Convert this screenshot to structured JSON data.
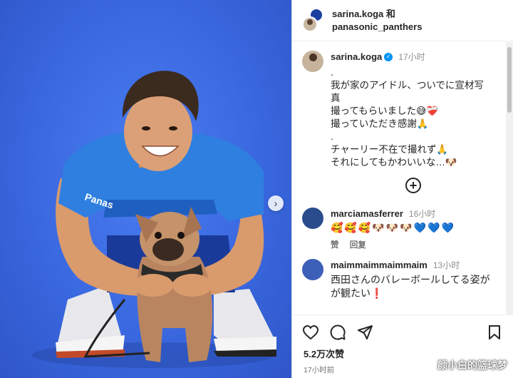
{
  "header": {
    "line1": "sarina.koga 和",
    "line2": "panasonic_panthers"
  },
  "post": {
    "username": "sarina.koga",
    "time": "17小时",
    "caption_lines": [
      ".",
      "我が家のアイドル、ついでに宣材写",
      "真",
      "撮ってもらいました😅❤️‍🩹",
      "撮っていただき感謝🙏",
      ".",
      "チャーリー不在で撮れず🙏",
      "それにしてもかわいいな…🐶"
    ]
  },
  "comments": [
    {
      "username": "marciamasferrer",
      "time": "16小时",
      "text": "🥰🥰🥰🐶🐶🐶",
      "hearts": "💙💙💙",
      "like_label": "赞",
      "reply_label": "回复",
      "avatar_color": "#2a4b8c"
    },
    {
      "username": "maimmaimmaimmaim",
      "time": "13小时",
      "text": "西田さんのバレーボールしてる姿がが観たい❗",
      "avatar_color": "#3c5fb8"
    }
  ],
  "actions": {
    "likes": "5.2万次赞",
    "ago": "17小时前"
  },
  "watermark": "颜小白的篮球梦",
  "photo": {
    "jersey_text": "Panas"
  }
}
